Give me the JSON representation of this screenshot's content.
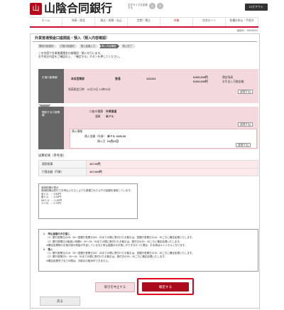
{
  "header": {
    "logo_mark": "山",
    "bank_name": "山陰合同銀行",
    "font_size_label": "文字サイズを変更する",
    "font_size_small": "小",
    "font_size_large": "大",
    "logout": "ログアウト"
  },
  "nav": [
    "ホーム",
    "残高・照会",
    "振込・振替・払込",
    "定期・積立",
    "外貨",
    "住宅ローン",
    "各種お申込・手続き"
  ],
  "screen_id": "画面ID：IMKW004",
  "page_title": "外貨普通預金口座開設・預入（預入内容確認）",
  "steps": [
    "開設口座選択",
    "引落口座選択",
    "預入金額入力",
    "預入内容確認",
    "預入完了"
  ],
  "notes": [
    "この内容で外貨普通預金口座開設・預入を行います。",
    "お手続き内容をご確認の上、「確定する」ボタンを押してください。"
  ],
  "debit": {
    "header": "引落口座情報",
    "branch": "本店営業部",
    "type": "普通",
    "account": "1111111",
    "balance": "5,000,000円",
    "balance_label": "預金残高",
    "available": "5,000,000円",
    "available_label": "お引出し可能金額",
    "date_text": "残高照会日時　01月22日 10時00分",
    "change_btn": "[変更する]"
  },
  "open": {
    "header": "開設する口座情報",
    "account_type_label": "口座の種類",
    "account_type": "外貨普通",
    "currency_label": "通貨",
    "currency": "米ドル",
    "change_btn": "[変更する]",
    "deposit_header": "預入情報",
    "amount_label": "預入金額（外貨）",
    "amount": "米ドル 1000.00",
    "date_label": "預入日",
    "date": "01月22日",
    "change_btn2": "[変更する]"
  },
  "result": {
    "title": "試算結果（参考値）",
    "rows": [
      {
        "k": "適用相場",
        "v": "107.00円"
      },
      {
        "k": "引落金額（円貨）",
        "v": "107,000円"
      }
    ]
  },
  "rates": {
    "title": "適用相場の表示",
    "desc": "適用相場は窓口でお申込いただくよりも優遇された以下の金額を適用しています。",
    "items": [
      "米ドル　：0.50円",
      "豪ドル　：1.00円",
      "NZドル　：1.00円",
      "ユーロ　：0.70円"
    ]
  },
  "warn": {
    "t1": "1.　申込金額のお引落し",
    "p1": [
      "（1）銀行営業日の15：00〜翌銀行営業日の9：30までの間に受付けたお取引は、翌銀行営業日の10：30ごろに確定処理いたします。",
      "（2）銀行営業日の取扱い時間9：30〜15：00までの間に受付けたお取引は、受付日の15：00ごろに確定処理いたします。",
      "※確定処理時の引落口座の残高が不足しているなど申込金額のお引落しができなかった場合、お手続はキャンセルとなります。"
    ],
    "t2": "2.　預入",
    "p2": [
      "（1）銀行営業日の15：00〜翌銀行営業日の9：30までの間に受付けたお取引は、翌銀行営業日の10：30ごろに確定処理いたします。",
      "（2）銀行営業日9：30〜15：00までの間に受付けたお取引は、受付日の15：00ごろに確定処理いたします。"
    ],
    "p3": "※確定処理完了までの間は、お取引の取消ができません。"
  },
  "buttons": {
    "cancel": "取引を中止する",
    "confirm": "確定する",
    "back": "戻る"
  }
}
